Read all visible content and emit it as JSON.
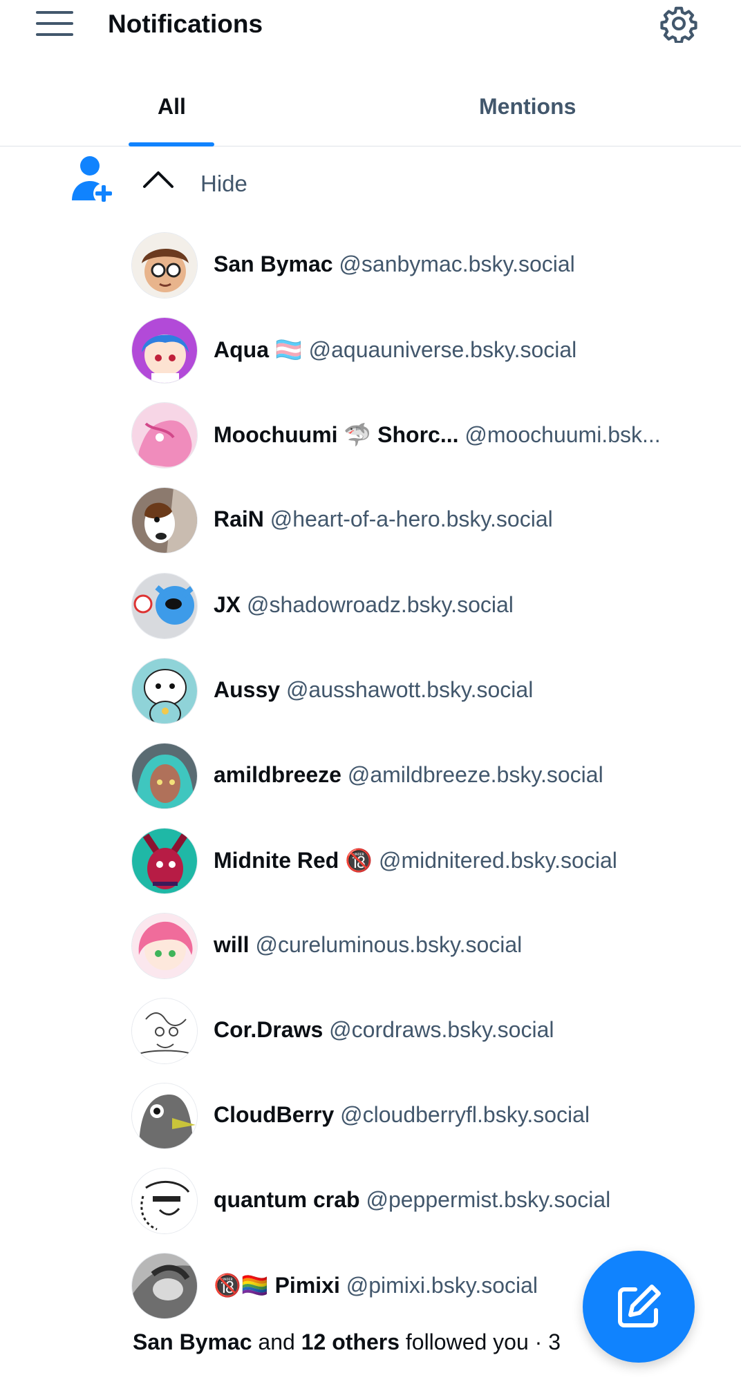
{
  "header": {
    "title": "Notifications",
    "menu_icon": "hamburger-menu-icon",
    "settings_icon": "gear-icon"
  },
  "tabs": [
    {
      "label": "All",
      "active": true
    },
    {
      "label": "Mentions",
      "active": false
    }
  ],
  "group": {
    "icon": "person-add-icon",
    "toggle_icon": "chevron-up-icon",
    "toggle_label": "Hide",
    "followers": [
      {
        "name": "San Bymac",
        "handle": "@sanbymac.bsky.social"
      },
      {
        "name": "Aqua 🏳️‍⚧️",
        "handle": "@aquauniverse.bsky.social"
      },
      {
        "name": "Moochuumi 🦈 Shorc...",
        "handle": "@moochuumi.bsk..."
      },
      {
        "name": "RaiN",
        "handle": "@heart-of-a-hero.bsky.social"
      },
      {
        "name": "JX",
        "handle": "@shadowroadz.bsky.social"
      },
      {
        "name": "Aussy",
        "handle": "@ausshawott.bsky.social"
      },
      {
        "name": "amildbreeze",
        "handle": "@amildbreeze.bsky.social"
      },
      {
        "name": "Midnite Red 🔞",
        "handle": "@midnitered.bsky.social"
      },
      {
        "name": "will",
        "handle": "@cureluminous.bsky.social"
      },
      {
        "name": "Cor.Draws",
        "handle": "@cordraws.bsky.social"
      },
      {
        "name": "CloudBerry",
        "handle": "@cloudberryfl.bsky.social"
      },
      {
        "name": "quantum crab",
        "handle": "@peppermist.bsky.social"
      },
      {
        "name": "🔞🏳️‍🌈 Pimixi",
        "handle": "@pimixi.bsky.social"
      }
    ],
    "summary": {
      "first_name": "San Bymac",
      "and": " and ",
      "others": "12 others",
      "action": " followed you · 3"
    }
  },
  "fab": {
    "icon": "compose-icon"
  },
  "colors": {
    "accent": "#1083fe",
    "muted": "#42576c",
    "text": "#0b0f14"
  }
}
